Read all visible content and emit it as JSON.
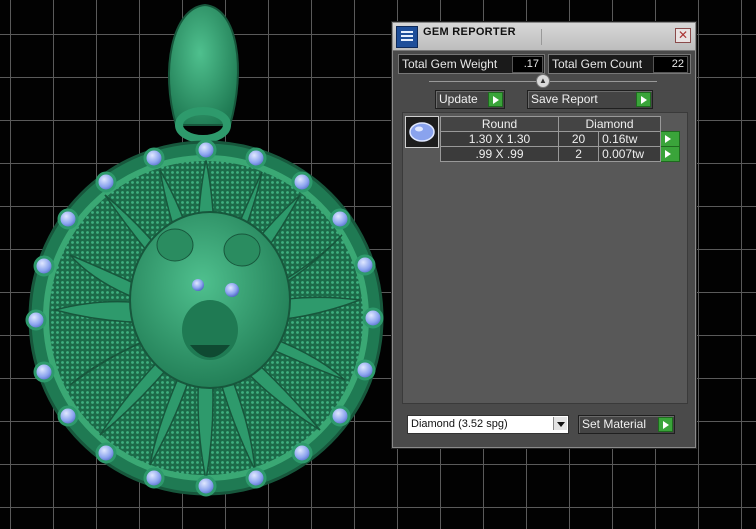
{
  "panel": {
    "title": "GEM REPORTER",
    "close_glyph": "✕",
    "total_weight_label": "Total Gem Weight",
    "total_weight_value": ".17",
    "total_count_label": "Total Gem Count",
    "total_count_value": "22",
    "update_label": "Update",
    "save_report_label": "Save Report",
    "table": {
      "headers": [
        "Round",
        "Diamond"
      ],
      "rows": [
        {
          "size": "1.30 X 1.30",
          "count": "20",
          "weight": "0.16tw"
        },
        {
          "size": ".99 X .99",
          "count": "2",
          "weight": "0.007tw"
        }
      ]
    },
    "material_selected": "Diamond     (3.52 spg)",
    "set_material_label": "Set Material"
  },
  "colors": {
    "metal": "#2e9a6c",
    "metal_dark": "#17573c",
    "gem": "#8aa3ee",
    "go_button": "#3aa43a"
  },
  "icons": [
    "gem-reporter-app-icon",
    "close-icon",
    "slider-knob-icon",
    "go-arrow-icon",
    "dropdown-arrow-icon",
    "gem-thumbnail-icon"
  ]
}
